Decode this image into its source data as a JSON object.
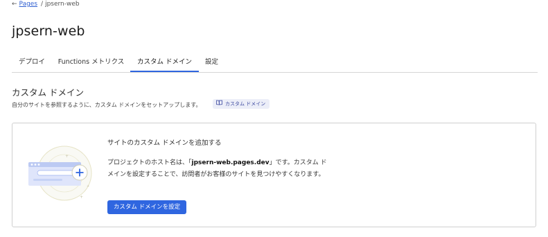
{
  "breadcrumb": {
    "back_icon": "arrow-left-icon",
    "parent_label": "Pages",
    "separator": "/",
    "current_label": "jpsern-web"
  },
  "page_title": "jpsern-web",
  "tabs": [
    {
      "label": "デプロイ",
      "active": false
    },
    {
      "label": "Functions メトリクス",
      "active": false
    },
    {
      "label": "カスタム ドメイン",
      "active": true
    },
    {
      "label": "設定",
      "active": false
    }
  ],
  "section": {
    "title": "カスタム ドメイン",
    "description": "自分のサイトを参照するように、カスタム ドメインをセットアップします。",
    "doc_badge": {
      "icon": "book-icon",
      "label": "カスタム ドメイン"
    }
  },
  "card": {
    "illustration_icon": "add-domain-illustration",
    "heading": "サイトのカスタム ドメインを追加する",
    "body_before": "プロジェクトのホスト名は、「",
    "body_code": "jpsern-web.pages.dev",
    "body_after": "」です。カスタム ドメインを設定することで、訪問者がお客様のサイトを見つけやすくなります。",
    "button_label": "カスタム ドメインを設定"
  },
  "colors": {
    "accent": "#2f66e0",
    "link": "#2f5fd1",
    "badge_bg": "#eceef8",
    "border": "#cfcfcf"
  }
}
